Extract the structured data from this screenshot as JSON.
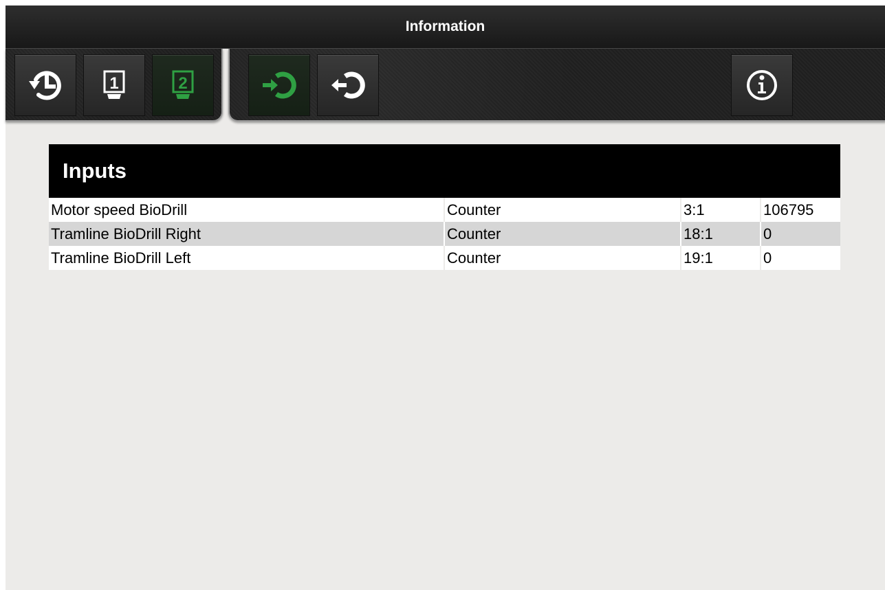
{
  "window": {
    "title": "Information"
  },
  "toolbar": {
    "left_buttons": [
      {
        "icon": "history-icon",
        "active": false
      },
      {
        "icon": "terminal-1-icon",
        "label": "1",
        "active": false
      },
      {
        "icon": "terminal-2-icon",
        "label": "2",
        "active": true
      }
    ],
    "right_buttons": [
      {
        "icon": "input-icon",
        "active": true
      },
      {
        "icon": "output-icon",
        "active": false
      },
      {
        "icon": "info-icon",
        "active": false
      }
    ]
  },
  "colors": {
    "accent_green": "#2fa043",
    "header_bg": "#000000",
    "row_alt": "#d6d6d6",
    "page_bg": "#ecebe9"
  },
  "inputs": {
    "title": "Inputs",
    "rows": [
      {
        "name": "Motor speed BioDrill",
        "type": "Counter",
        "address": "3:1",
        "value": "106795"
      },
      {
        "name": "Tramline BioDrill Right",
        "type": "Counter",
        "address": "18:1",
        "value": "0"
      },
      {
        "name": "Tramline BioDrill Left",
        "type": "Counter",
        "address": "19:1",
        "value": "0"
      }
    ]
  }
}
